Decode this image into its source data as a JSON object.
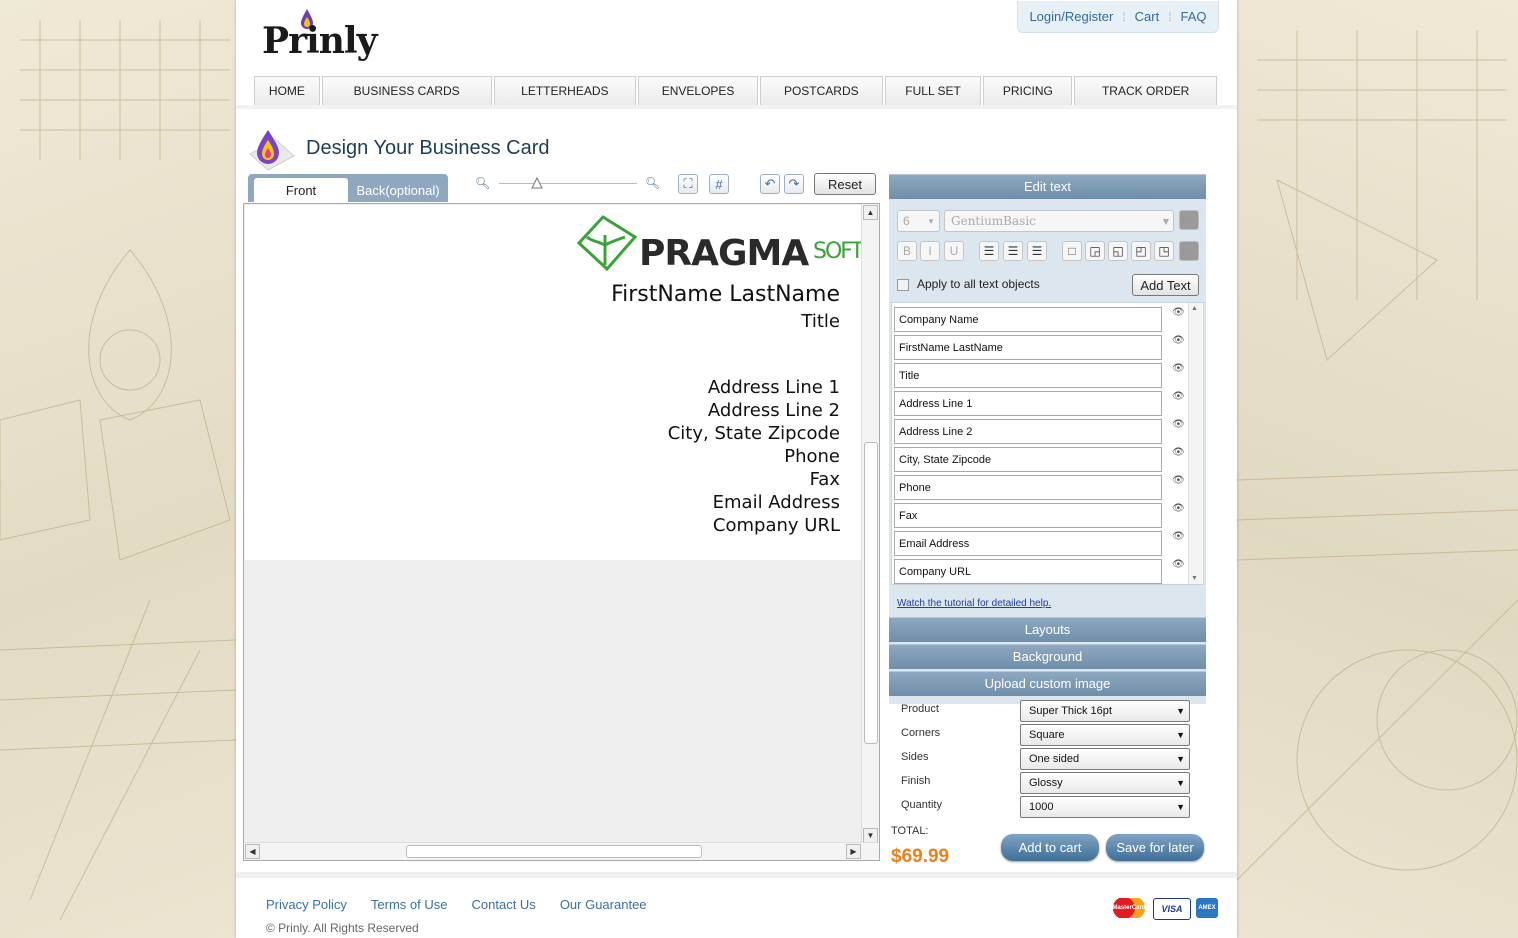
{
  "brand": {
    "name": "Prinly"
  },
  "top_links": [
    "Login/Register",
    "Cart",
    "FAQ"
  ],
  "nav": [
    "HOME",
    "BUSINESS CARDS",
    "LETTERHEADS",
    "ENVELOPES",
    "POSTCARDS",
    "FULL SET",
    "PRICING",
    "TRACK ORDER"
  ],
  "page_title": "Design Your Business Card",
  "tabs": {
    "front": "Front",
    "back": "Back(optional)"
  },
  "toolbar": {
    "reset": "Reset"
  },
  "card": {
    "logo_text": "PRAGMA",
    "logo_suffix": "SOFT",
    "name": "FirstName LastName",
    "title": "Title",
    "address1": "Address Line 1",
    "address2": "Address Line 2",
    "city": "City, State Zipcode",
    "phone": "Phone",
    "fax": "Fax",
    "email": "Email Address",
    "url": "Company URL"
  },
  "edit_text": {
    "header": "Edit text",
    "font_size": "6",
    "font_family": "GentiumBasic",
    "bold": "B",
    "italic": "I",
    "underline": "U",
    "apply_all": "Apply to all text objects",
    "add_text": "Add Text",
    "fields": [
      "Company Name",
      "FirstName LastName",
      "Title",
      "Address Line 1",
      "Address Line 2",
      "City, State Zipcode",
      "Phone",
      "Fax",
      "Email Address",
      "Company URL"
    ],
    "tutorial": "Watch the tutorial for detailed help."
  },
  "sections": {
    "layouts": "Layouts",
    "background": "Background",
    "upload": "Upload custom image"
  },
  "options": [
    {
      "label": "Product",
      "value": "Super Thick 16pt"
    },
    {
      "label": "Corners",
      "value": "Square"
    },
    {
      "label": "Sides",
      "value": "One sided"
    },
    {
      "label": "Finish",
      "value": "Glossy"
    },
    {
      "label": "Quantity",
      "value": "1000"
    }
  ],
  "total": {
    "label": "TOTAL:",
    "price": "$69.99"
  },
  "actions": {
    "add_to_cart": "Add to cart",
    "save_later": "Save for later"
  },
  "footer": {
    "links": [
      "Privacy Policy",
      "Terms of Use",
      "Contact Us",
      "Our Guarantee"
    ],
    "copyright": "© Prinly. All Rights Reserved",
    "payment": [
      "MasterCard",
      "VISA",
      "AMEX"
    ]
  },
  "colors": {
    "accent": "#6f8ea9",
    "price": "#ef7f1a",
    "link": "#3a70a0"
  }
}
